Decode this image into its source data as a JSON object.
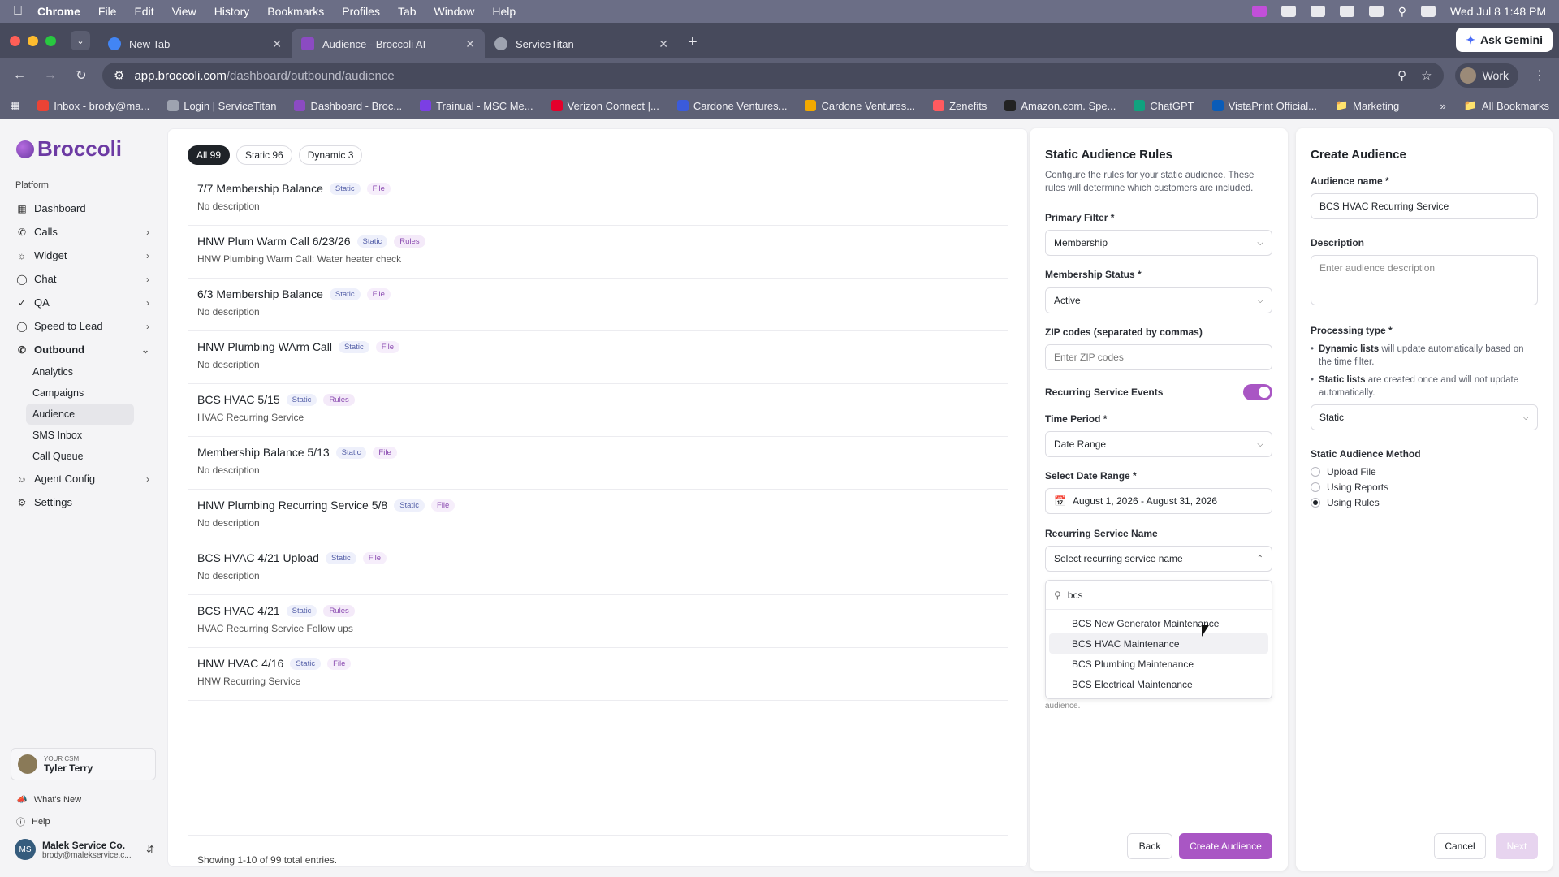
{
  "menubar": {
    "app": "Chrome",
    "items": [
      "File",
      "Edit",
      "View",
      "History",
      "Bookmarks",
      "Profiles",
      "Tab",
      "Window",
      "Help"
    ],
    "clock": "Wed Jul 8  1:48 PM"
  },
  "tabs": [
    {
      "title": "New Tab",
      "favicon_color": "#4285f4"
    },
    {
      "title": "Audience - Broccoli AI",
      "favicon_color": "#8b4bc2"
    },
    {
      "title": "ServiceTitan",
      "favicon_color": "#9ea3b0"
    }
  ],
  "ask_gemini": "Ask Gemini",
  "address": {
    "host": "app.broccoli.com",
    "path": "/dashboard/outbound/audience"
  },
  "profile": "Work",
  "bookmarks": [
    {
      "label": "Inbox - brody@ma...",
      "color": "#ea4335"
    },
    {
      "label": "Login | ServiceTitan",
      "color": "#9ea3b0"
    },
    {
      "label": "Dashboard - Broc...",
      "color": "#8b4bc2"
    },
    {
      "label": "Trainual - MSC Me...",
      "color": "#7b3fe4"
    },
    {
      "label": "Verizon Connect |...",
      "color": "#e4002b"
    },
    {
      "label": "Cardone Ventures...",
      "color": "#3b5bdb"
    },
    {
      "label": "Cardone Ventures...",
      "color": "#f2a900"
    },
    {
      "label": "Zenefits",
      "color": "#ff5a5f"
    },
    {
      "label": "Amazon.com. Spe...",
      "color": "#222222"
    },
    {
      "label": "ChatGPT",
      "color": "#10a37f"
    },
    {
      "label": "VistaPrint Official...",
      "color": "#0a5cb8"
    },
    {
      "label": "Marketing",
      "color": "#d0d0d8"
    }
  ],
  "all_bookmarks": "All Bookmarks",
  "sidebar": {
    "brand": "Broccoli",
    "section": "Platform",
    "items": [
      {
        "label": "Dashboard",
        "icon": "dashboard-icon",
        "chev": ""
      },
      {
        "label": "Calls",
        "icon": "phone-icon",
        "chev": "›"
      },
      {
        "label": "Widget",
        "icon": "widget-icon",
        "chev": "›"
      },
      {
        "label": "Chat",
        "icon": "chat-icon",
        "chev": "›"
      },
      {
        "label": "QA",
        "icon": "qa-icon",
        "chev": "›"
      },
      {
        "label": "Speed to Lead",
        "icon": "speed-icon",
        "chev": "›"
      },
      {
        "label": "Outbound",
        "icon": "outbound-icon",
        "chev": "⌄"
      }
    ],
    "sub_items": [
      "Analytics",
      "Campaigns",
      "Audience",
      "SMS Inbox",
      "Call Queue"
    ],
    "lower_items": [
      {
        "label": "Agent Config",
        "icon": "agent-icon",
        "chev": "›"
      },
      {
        "label": "Settings",
        "icon": "settings-icon",
        "chev": ""
      }
    ],
    "csm_caption": "YOUR CSM",
    "csm_name": "Tyler Terry",
    "whats_new": "What's New",
    "help": "Help",
    "account_name": "Malek Service Co.",
    "account_email": "brody@malekservice.c..."
  },
  "filters": [
    "All 99",
    "Static 96",
    "Dynamic 3"
  ],
  "audiences": [
    {
      "name": "7/7 Membership Balance",
      "type": "Static",
      "source": "File",
      "desc": "No description"
    },
    {
      "name": "HNW Plum Warm Call 6/23/26",
      "type": "Static",
      "source": "Rules",
      "desc": "HNW Plumbing Warm Call: Water heater check"
    },
    {
      "name": "6/3 Membership Balance",
      "type": "Static",
      "source": "File",
      "desc": "No description"
    },
    {
      "name": "HNW Plumbing WArm Call",
      "type": "Static",
      "source": "File",
      "desc": "No description"
    },
    {
      "name": "BCS HVAC 5/15",
      "type": "Static",
      "source": "Rules",
      "desc": "HVAC Recurring Service"
    },
    {
      "name": "Membership Balance 5/13",
      "type": "Static",
      "source": "File",
      "desc": "No description"
    },
    {
      "name": "HNW Plumbing Recurring Service 5/8",
      "type": "Static",
      "source": "File",
      "desc": "No description"
    },
    {
      "name": "BCS HVAC 4/21 Upload",
      "type": "Static",
      "source": "File",
      "desc": "No description"
    },
    {
      "name": "BCS HVAC 4/21",
      "type": "Static",
      "source": "Rules",
      "desc": "HVAC Recurring Service Follow ups"
    },
    {
      "name": "HNW HVAC 4/16",
      "type": "Static",
      "source": "File",
      "desc": "HNW Recurring Service"
    }
  ],
  "showing": "Showing 1-10 of 99 total entries.",
  "rules_panel": {
    "title": "Static Audience Rules",
    "subtitle": "Configure the rules for your static audience. These rules will determine which customers are included.",
    "primary_filter_label": "Primary Filter *",
    "primary_filter_value": "Membership",
    "membership_status_label": "Membership Status *",
    "membership_status_value": "Active",
    "zip_label": "ZIP codes (separated by commas)",
    "zip_placeholder": "Enter ZIP codes",
    "recurring_label": "Recurring Service Events",
    "time_period_label": "Time Period *",
    "time_period_value": "Date Range",
    "date_range_label": "Select Date Range *",
    "date_range_value": "August 1, 2026 - August 31, 2026",
    "service_name_label": "Recurring Service Name",
    "service_name_placeholder": "Select recurring service name",
    "search_value": "bcs",
    "options": [
      "BCS New Generator Maintenance",
      "BCS HVAC Maintenance",
      "BCS Plumbing Maintenance",
      "BCS Electrical Maintenance"
    ],
    "below_text": "audience.",
    "back": "Back",
    "create": "Create Audience"
  },
  "create_panel": {
    "title": "Create Audience",
    "name_label": "Audience name *",
    "name_value": "BCS HVAC Recurring Service",
    "desc_label": "Description",
    "desc_placeholder": "Enter audience description",
    "ptype_label": "Processing type *",
    "dynamic_bold": "Dynamic lists",
    "dynamic_rest": " will update automatically based on the time filter.",
    "static_bold": "Static lists",
    "static_rest": " are created once and will not update automatically.",
    "ptype_value": "Static",
    "method_label": "Static Audience Method",
    "methods": [
      "Upload File",
      "Using Reports",
      "Using Rules"
    ],
    "selected_method": "Using Rules",
    "cancel": "Cancel",
    "next": "Next"
  },
  "colors": {
    "accent": "#a956c4",
    "brand": "#6c3aa3"
  }
}
